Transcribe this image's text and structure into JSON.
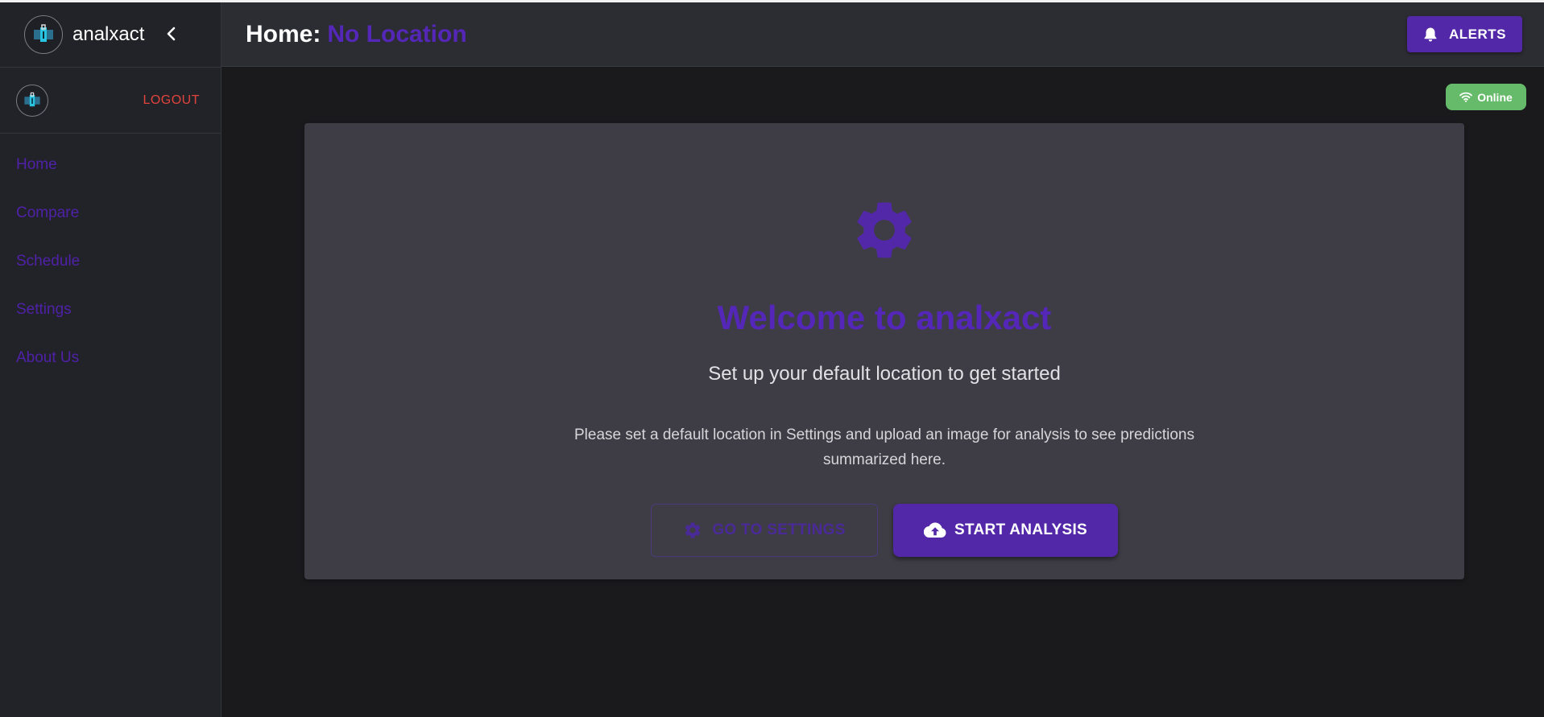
{
  "brand": {
    "name": "analxact",
    "logo_icon": "analxact-logo-icon",
    "collapse_glyph": "‹"
  },
  "user": {
    "logout_label": "LOGOUT"
  },
  "sidebar": {
    "items": [
      {
        "label": "Home"
      },
      {
        "label": "Compare"
      },
      {
        "label": "Schedule"
      },
      {
        "label": "Settings"
      },
      {
        "label": "About Us"
      }
    ]
  },
  "header": {
    "title_prefix": "Home:",
    "location": "No Location",
    "alerts_label": "ALERTS"
  },
  "status": {
    "label": "Online"
  },
  "welcome": {
    "title": "Welcome to analxact",
    "subtitle": "Set up your default location to get started",
    "description": "Please set a default location in Settings and upload an image for analysis to see predictions summarized here.",
    "settings_button": "GO TO SETTINGS",
    "start_button": "START ANALYSIS"
  },
  "colors": {
    "accent": "#5328a8",
    "accent_text": "#5427b8",
    "logout": "#e0443c",
    "online": "#66bb6a",
    "card": "#3e3d45",
    "sidebar": "#222328"
  }
}
